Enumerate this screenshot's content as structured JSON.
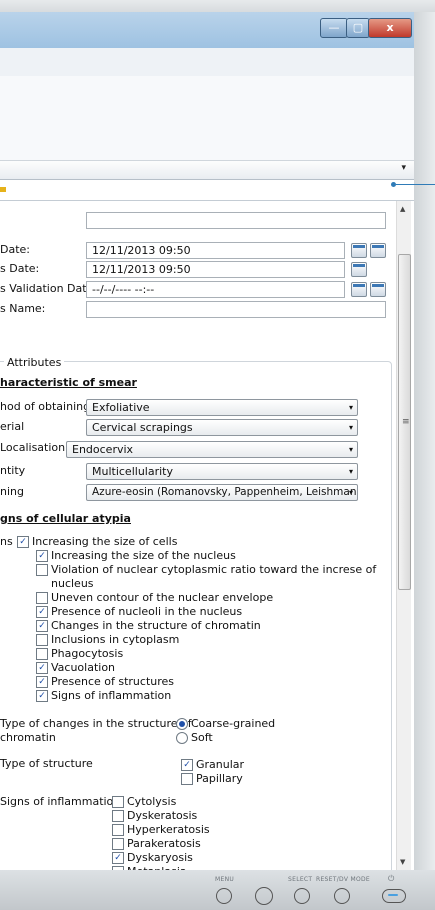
{
  "window": {
    "min_glyph": "—",
    "max_glyph": "▢",
    "close_glyph": "x"
  },
  "form": {
    "dates": [
      {
        "label": "",
        "value": ""
      },
      {
        "label": "Date:",
        "value": "12/11/2013 09:50"
      },
      {
        "label": "s Date:",
        "value": "12/11/2013 09:50"
      },
      {
        "label": "s Validation Date:",
        "value": "--/--/---- --:--"
      },
      {
        "label": "s Name:",
        "value": ""
      }
    ],
    "attributes_legend": "Attributes",
    "section_smear": "haracteristic of smear",
    "selects": [
      {
        "label": "hod of obtaining",
        "value": "Exfoliative"
      },
      {
        "label": "erial",
        "value": "Cervical scrapings"
      },
      {
        "label": "Localisation",
        "value": "Endocervix"
      },
      {
        "label": "ntity",
        "value": "Multicellularity"
      },
      {
        "label": "ning",
        "value": "Azure-eosin (Romanovsky, Pappenheim, Leishman)"
      }
    ],
    "section_atypia": "gns of cellular atypia",
    "atypia_label": "ns",
    "atypia_items": [
      {
        "text": "Increasing the size of cells",
        "checked": true
      },
      {
        "text": "Increasing the size of the nucleus",
        "checked": true
      },
      {
        "text": "Violation of nuclear cytoplasmic ratio toward the increse of",
        "text2": "nucleus",
        "checked": false
      },
      {
        "text": "Uneven contour of the nuclear envelope",
        "checked": false
      },
      {
        "text": "Presence of nucleoli in the nucleus",
        "checked": true
      },
      {
        "text": "Changes in the structure of chromatin",
        "checked": true
      },
      {
        "text": "Inclusions in cytoplasm",
        "checked": false
      },
      {
        "text": "Phagocytosis",
        "checked": false
      },
      {
        "text": "Vacuolation",
        "checked": true
      },
      {
        "text": "Presence of structures",
        "checked": true
      },
      {
        "text": "Signs of inflammation",
        "checked": true
      }
    ],
    "chromatin_label_1": "Type of changes in the structure of",
    "chromatin_label_2": "chromatin",
    "chromatin_options": [
      {
        "text": "Coarse-grained",
        "selected": true
      },
      {
        "text": "Soft",
        "selected": false
      }
    ],
    "structure_label": "Type of structure",
    "structure_options": [
      {
        "text": "Granular",
        "checked": true
      },
      {
        "text": "Papillary",
        "checked": false
      }
    ],
    "inflammation_label": "Signs of inflammation",
    "inflammation_options": [
      {
        "text": "Cytolysis",
        "checked": false
      },
      {
        "text": "Dyskeratosis",
        "checked": false
      },
      {
        "text": "Hyperkeratosis",
        "checked": false
      },
      {
        "text": "Parakeratosis",
        "checked": false
      },
      {
        "text": "Dyskaryosis",
        "checked": true
      },
      {
        "text": "Metaplasia",
        "checked": false
      }
    ]
  },
  "bezel": {
    "menu": "MENU",
    "select": "SELECT",
    "reset": "RESET/DV MODE"
  },
  "icons": {
    "calendar": "calendar-icon",
    "check": "✓",
    "dropdown": "▾"
  },
  "colors": {
    "titlebar": "#a9c8e6",
    "close": "#c0392b",
    "accent": "#1f4fa8"
  }
}
